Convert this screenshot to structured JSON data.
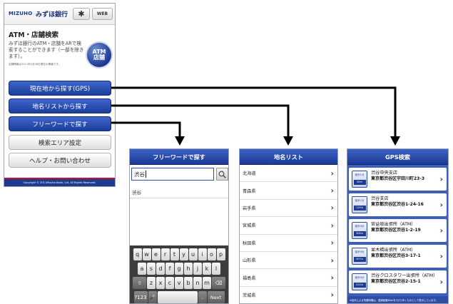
{
  "main": {
    "logo_en": "MIZUHO",
    "logo_jp": "みずほ銀行",
    "web_label": "WEB",
    "title": "ATM・店舗検索",
    "description": "みずほ銀行のATM・店舗をARで検索することができます（一部を除きます）。",
    "note": "店舗情報は2011年2月28日現在の情報です。",
    "atm_line1": "ATM",
    "atm_line2": "店舗",
    "buttons": {
      "gps": "現在地から探す(GPS)",
      "place_list": "地名リストから探す",
      "free_word": "フリーワードで探す",
      "area_settings": "検索エリア設定",
      "help": "ヘルプ・お問い合わせ"
    },
    "copyright": "Copyright © 2011Mizuho Bank, Ltd. All Rights Reserved."
  },
  "free_word": {
    "title": "フリーワードで探す",
    "query": "渋谷",
    "suggestion": "渋谷",
    "keyboard": {
      "row1": [
        "q",
        "w",
        "e",
        "r",
        "t",
        "y",
        "u",
        "i",
        "o",
        "p"
      ],
      "row2": [
        "a",
        "s",
        "d",
        "f",
        "g",
        "h",
        "j",
        "k",
        "l"
      ],
      "row3": [
        "z",
        "x",
        "c",
        "v",
        "b",
        "n",
        "m"
      ],
      "next": "Next"
    }
  },
  "place_list": {
    "title": "地名リスト",
    "items": [
      "北海道",
      "青森県",
      "岩手県",
      "宮城県",
      "秋田県",
      "山形県",
      "福島県",
      "茨城県"
    ]
  },
  "gps": {
    "title": "GPS検索",
    "badge_label": "徒歩",
    "results": [
      {
        "walk": "徒歩1分",
        "dist": "90m",
        "name": "渋谷中央支店",
        "address": "東京都渋谷区宇田川町23-3"
      },
      {
        "walk": "徒歩1分",
        "dist": "115m",
        "name": "渋谷支店",
        "address": "東京都渋谷区渋谷1-24-16"
      },
      {
        "walk": "徒歩4分",
        "dist": "304m",
        "name": "宮益坂出張所（ATM）",
        "address": "東京都渋谷区渋谷1-2-19"
      },
      {
        "walk": "徒歩5分",
        "dist": "407m",
        "name": "並木橋出張所（ATM）",
        "address": "東京都渋谷区渋谷3-17-1"
      },
      {
        "walk": "徒歩5分",
        "dist": "412m",
        "name": "渋谷クロスタワー出張所（ATM）",
        "address": "東京都渋谷区渋谷2-15-1"
      }
    ],
    "footer": "※徒歩による所要時間は、直線距離80mを1分で歩くものとして表示しています。"
  }
}
